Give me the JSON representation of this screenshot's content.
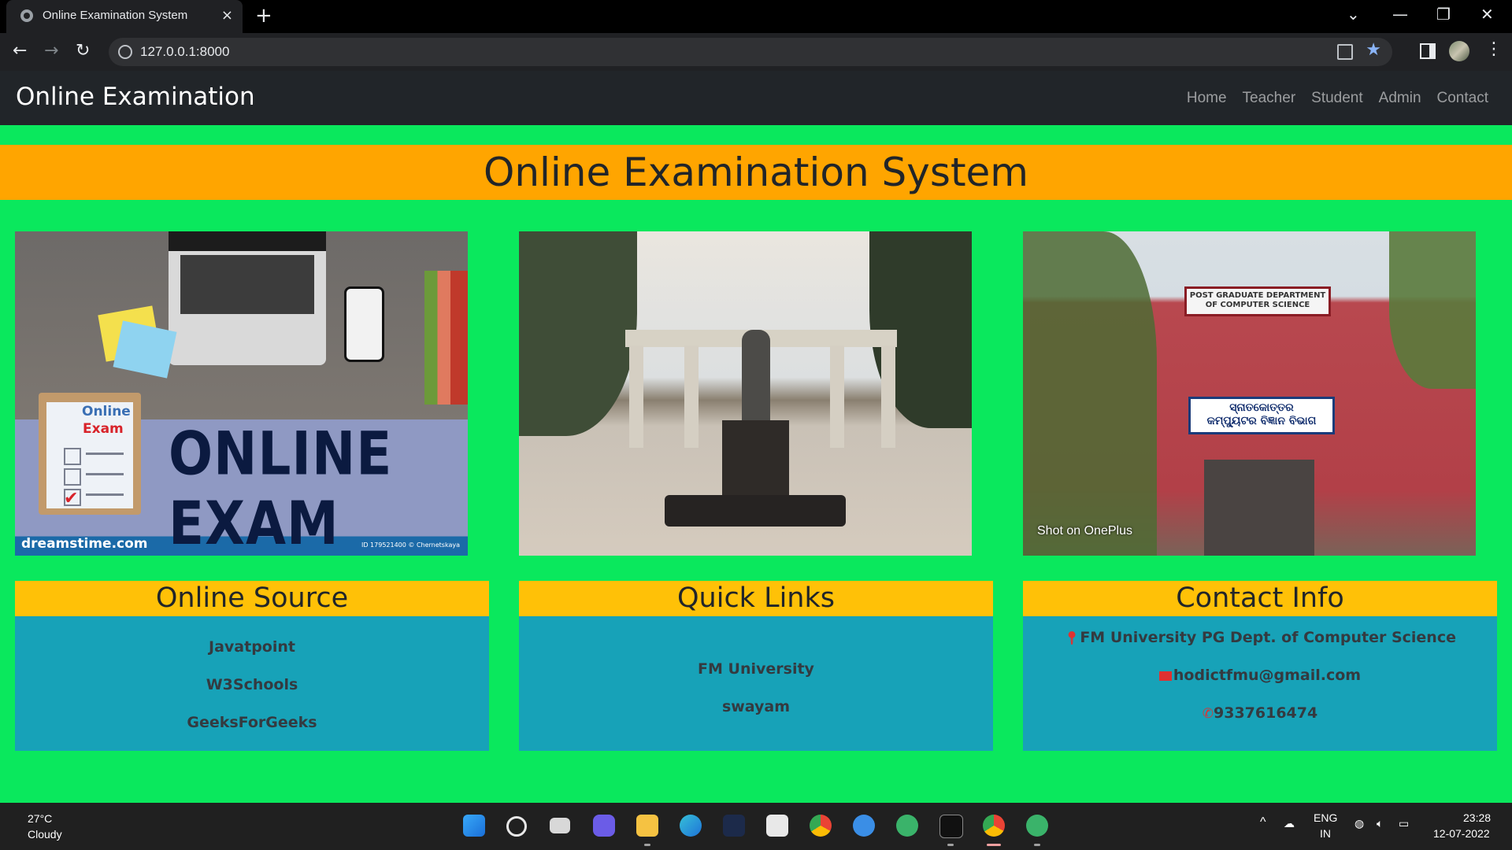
{
  "browser": {
    "tab_title": "Online Examination System",
    "url": "127.0.0.1:8000",
    "new_tab_label": "+",
    "close_tab_label": "×"
  },
  "navbar": {
    "brand": "Online Examination",
    "links": [
      "Home",
      "Teacher",
      "Student",
      "Admin",
      "Contact"
    ]
  },
  "hero": {
    "title": "Online Examination System"
  },
  "images": {
    "pic1": {
      "clipboard_line1": "Online",
      "clipboard_line2": "Exam",
      "banner_text": "ONLINE EXAM",
      "watermark": "dreamstime.com",
      "stock_id": "ID 179521400 © Chernetskaya"
    },
    "pic3": {
      "sign_text": "POST GRADUATE DEPARTMENT OF COMPUTER SCIENCE",
      "board_line1": "ସ୍ନାତକୋତ୍ତର",
      "board_line2": "କମ୍ପ୍ୟୁଟର ବିଜ୍ଞାନ ବିଭାଗ",
      "photo_caption": "Shot on OnePlus"
    }
  },
  "cards": {
    "online_source": {
      "title": "Online Source",
      "links": [
        "Javatpoint",
        "W3Schools",
        "GeeksForGeeks"
      ]
    },
    "quick_links": {
      "title": "Quick Links",
      "links": [
        "FM University",
        "swayam"
      ]
    },
    "contact_info": {
      "title": "Contact Info",
      "address": "FM University PG Dept. of Computer Science",
      "email": "hodictfmu@gmail.com",
      "phone": "9337616474"
    }
  },
  "taskbar": {
    "weather_temp": "27°C",
    "weather_desc": "Cloudy",
    "lang_line1": "ENG",
    "lang_line2": "IN",
    "time": "23:28",
    "date": "12-07-2022"
  },
  "colors": {
    "page_bg": "#0ae85d",
    "hero_bg": "#ffa500",
    "card_head_bg": "#ffc107",
    "card_body_bg": "#17a2b8",
    "navbar_bg": "#212529"
  }
}
